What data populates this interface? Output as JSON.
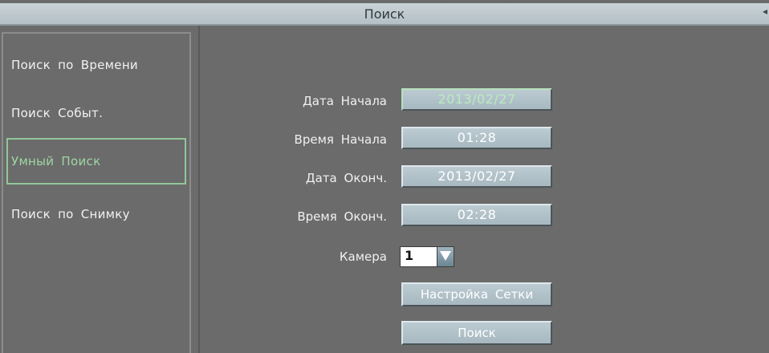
{
  "title": "Поиск",
  "sidebar": {
    "items": [
      {
        "label": "Поиск по Времени",
        "active": false
      },
      {
        "label": "Поиск Событ.",
        "active": false
      },
      {
        "label": "Умный Поиск",
        "active": true
      },
      {
        "label": "Поиск по Снимку",
        "active": false
      }
    ]
  },
  "form": {
    "start_date_label": "Дата Начала",
    "start_date_value": "2013/02/27",
    "start_time_label": "Время Начала",
    "start_time_value": "01:28",
    "end_date_label": "Дата Оконч.",
    "end_date_value": "2013/02/27",
    "end_time_label": "Время Оконч.",
    "end_time_value": "02:28",
    "camera_label": "Камера",
    "camera_value": "1",
    "grid_setup_label": "Настройка Сетки",
    "search_label": "Поиск"
  },
  "colors": {
    "background": "#6b6b6b",
    "active_accent": "#9fd6a4",
    "field_fill": "#b3c3ca"
  },
  "icons": {
    "dropdown": "chevron-down-icon",
    "corner": "back-arrow-icon"
  }
}
